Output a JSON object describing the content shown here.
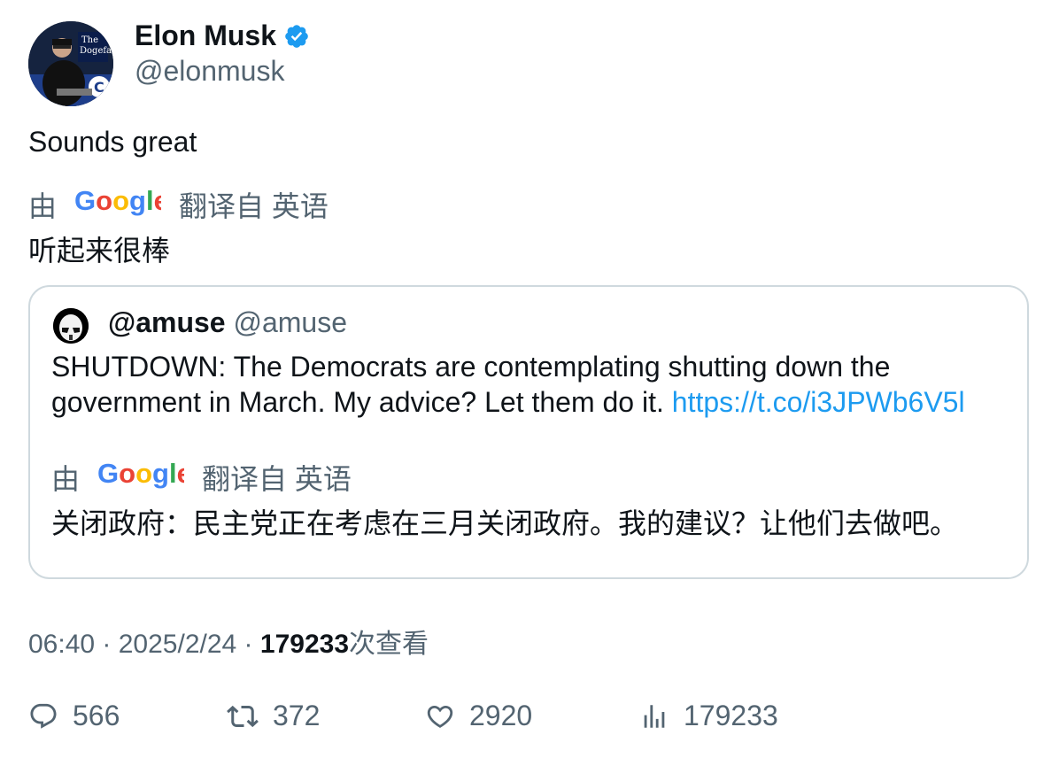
{
  "author": {
    "name": "Elon Musk",
    "handle": "@elonmusk"
  },
  "tweet_text": "Sounds great",
  "translation": {
    "prefix": "由",
    "google": "Google",
    "from_label": "翻译自 英语",
    "text": "听起来很棒"
  },
  "quote": {
    "name": "@amuse",
    "handle": "@amuse",
    "text": "SHUTDOWN: The Democrats are contemplating shutting down the government in March. My advice? Let them do it.",
    "link": "https://t.co/i3JPWb6V5l",
    "translation": {
      "prefix": "由",
      "google": "Google",
      "from_label": "翻译自 英语",
      "text": "关闭政府：民主党正在考虑在三月关闭政府。我的建议？让他们去做吧。"
    }
  },
  "meta": {
    "time": "06:40",
    "sep1": " · ",
    "date": "2025/2/24",
    "sep2": " · ",
    "views": "179233",
    "views_suffix": "次查看"
  },
  "actions": {
    "replies": "566",
    "retweets": "372",
    "likes": "2920",
    "views": "179233"
  },
  "colors": {
    "text": "#0f1419",
    "secondary": "#536471",
    "link": "#1d9bf0",
    "border": "#cfd9de",
    "verified": "#1d9bf0"
  }
}
